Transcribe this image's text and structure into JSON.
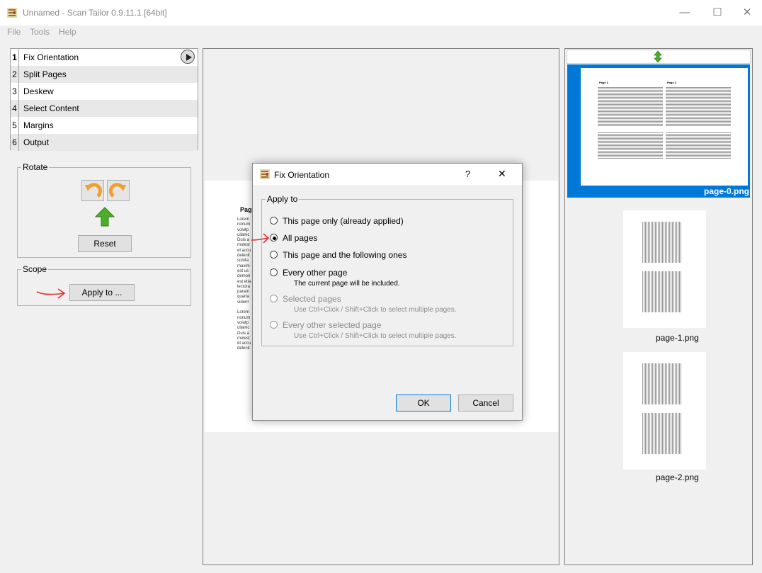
{
  "window": {
    "title": "Unnamed - Scan Tailor 0.9.11.1 [64bit]",
    "minimize": "—",
    "maximize": "☐",
    "close": "✕"
  },
  "menu": [
    "File",
    "Tools",
    "Help"
  ],
  "steps": [
    {
      "num": "1",
      "label": "Fix Orientation",
      "active": true
    },
    {
      "num": "2",
      "label": "Split Pages"
    },
    {
      "num": "3",
      "label": "Deskew"
    },
    {
      "num": "4",
      "label": "Select Content"
    },
    {
      "num": "5",
      "label": "Margins"
    },
    {
      "num": "6",
      "label": "Output"
    }
  ],
  "rotate": {
    "title": "Rotate",
    "reset": "Reset"
  },
  "scope": {
    "title": "Scope",
    "apply_to": "Apply to ..."
  },
  "preview": {
    "page_heading": "Page",
    "text_lines": [
      "Lorem",
      "nonum",
      "volutp",
      "ullamc",
      "Duis a",
      "molest",
      "et accu",
      "delenit",
      "soluta",
      "maxim",
      "est us",
      "demon",
      "est etia",
      "lectora",
      "param",
      "quarta",
      "vident",
      "",
      "Lorem",
      "nonum",
      "volutp",
      "ullamc",
      "Duis a",
      "molest",
      "et accu",
      "delenit"
    ]
  },
  "thumbnails": [
    {
      "caption": "page-0.png",
      "selected": true,
      "left_heading": "Page 1",
      "right_heading": "Page 2"
    },
    {
      "caption": "page-1.png",
      "selected": false
    },
    {
      "caption": "page-2.png",
      "selected": false
    }
  ],
  "dialog": {
    "title": "Fix Orientation",
    "help": "?",
    "close": "✕",
    "group_title": "Apply to",
    "options": [
      {
        "label": "This page only (already applied)",
        "hint": "",
        "checked": false,
        "disabled": false
      },
      {
        "label": "All pages",
        "hint": "",
        "checked": true,
        "disabled": false
      },
      {
        "label": "This page and the following ones",
        "hint": "",
        "checked": false,
        "disabled": false
      },
      {
        "label": "Every other page",
        "hint": "The current page will be included.",
        "checked": false,
        "disabled": false
      },
      {
        "label": "Selected pages",
        "hint": "Use Ctrl+Click / Shift+Click to select multiple pages.",
        "checked": false,
        "disabled": true
      },
      {
        "label": "Every other selected page",
        "hint": "Use Ctrl+Click / Shift+Click to select multiple pages.",
        "checked": false,
        "disabled": true
      }
    ],
    "ok": "OK",
    "cancel": "Cancel"
  },
  "colors": {
    "selection": "#0078d7",
    "annotation_arrow": "#e53030",
    "rotate_arrow": "#f0a030",
    "up_arrow": "#4caf2a"
  }
}
